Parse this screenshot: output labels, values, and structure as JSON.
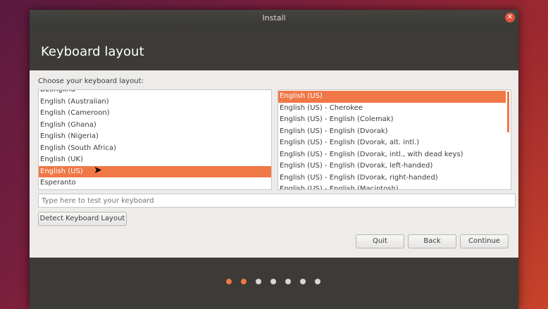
{
  "window": {
    "title": "Install"
  },
  "header": {
    "title": "Keyboard layout"
  },
  "prompt": "Choose your keyboard layout:",
  "languages": [
    "Dzongkha",
    "English (Australian)",
    "English (Cameroon)",
    "English (Ghana)",
    "English (Nigeria)",
    "English (South Africa)",
    "English (UK)",
    "English (US)",
    "Esperanto"
  ],
  "variants": [
    "English (US)",
    "English (US) - Cherokee",
    "English (US) - English (Colemak)",
    "English (US) - English (Dvorak)",
    "English (US) - English (Dvorak, alt. intl.)",
    "English (US) - English (Dvorak, intl., with dead keys)",
    "English (US) - English (Dvorak, left-handed)",
    "English (US) - English (Dvorak, right-handed)",
    "English (US) - English (Macintosh)"
  ],
  "test_input": {
    "placeholder": "Type here to test your keyboard",
    "value": ""
  },
  "buttons": {
    "detect": "Detect Keyboard Layout",
    "quit": "Quit",
    "back": "Back",
    "continue": "Continue"
  },
  "progress": {
    "total_steps": 7,
    "current_step": 2
  },
  "colors": {
    "accent": "#f07746",
    "window": "#3c3b37",
    "content": "#edeceb"
  },
  "icons": {
    "close": "close-icon",
    "cursor": "mouse-pointer-icon"
  }
}
